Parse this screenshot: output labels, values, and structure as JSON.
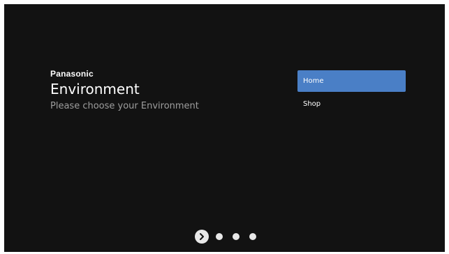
{
  "header": {
    "brand": "Panasonic",
    "title": "Environment",
    "subtitle": "Please choose your Environment"
  },
  "options": [
    {
      "label": "Home",
      "selected": true
    },
    {
      "label": "Shop",
      "selected": false
    }
  ],
  "pager": {
    "next_icon": "chevron-right-icon",
    "dots": 3
  },
  "colors": {
    "background": "#121212",
    "selected": "#4a7fc6",
    "subtitle": "#9e9e9e"
  }
}
